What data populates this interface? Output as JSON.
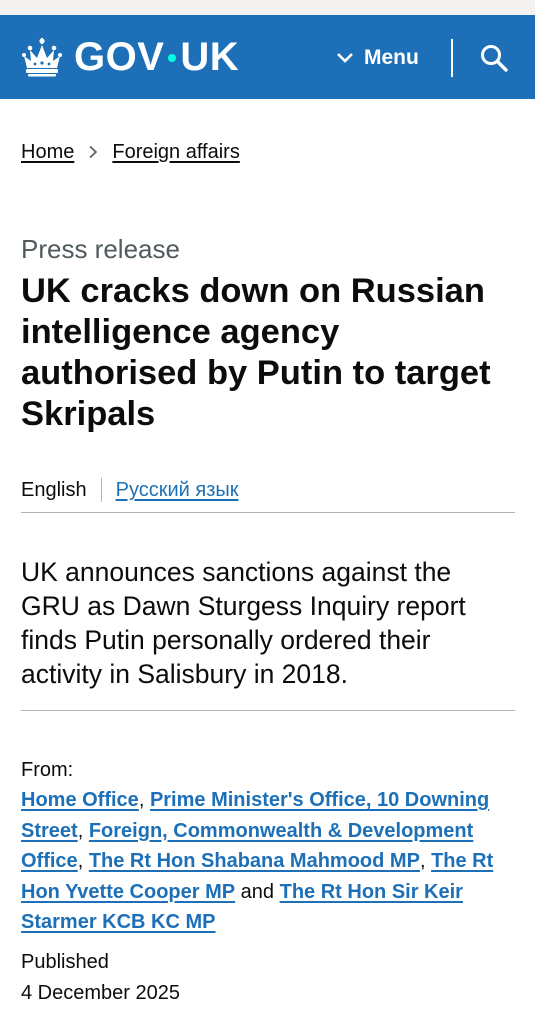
{
  "colors": {
    "header_bg": "#1d70b8",
    "link": "#1d70b8",
    "text": "#0b0c0c",
    "secondary_text": "#505a5f",
    "logo_dot": "#00ffe0"
  },
  "header": {
    "logo_icon": "crown-icon",
    "logo_left": "GOV",
    "logo_right": "UK",
    "menu_label": "Menu",
    "menu_icon": "chevron-down-icon",
    "search_icon": "search-icon"
  },
  "breadcrumb": {
    "items": [
      "Home",
      "Foreign affairs"
    ],
    "separator_icon": "chevron-right-icon"
  },
  "article": {
    "caption": "Press release",
    "title": "UK cracks down on Russian intelligence agency authorised by Putin to target Skripals",
    "languages": {
      "current": "English",
      "other": "Русский язык"
    },
    "lede": "UK announces sanctions against the GRU as Dawn Sturgess Inquiry report finds Putin personally ordered their activity in Salisbury in 2018.",
    "from_label": "From:",
    "from": [
      "Home Office",
      "Prime Minister's Office, 10 Downing Street",
      "Foreign, Commonwealth & Development Office",
      "The Rt Hon Shabana Mahmood MP",
      "The Rt Hon Yvette Cooper MP",
      "The Rt Hon Sir Keir Starmer KCB KC MP"
    ],
    "separators": [
      ", ",
      ", ",
      ", ",
      ", ",
      " and "
    ],
    "published_label": "Published",
    "published_date": "4 December 2025"
  }
}
